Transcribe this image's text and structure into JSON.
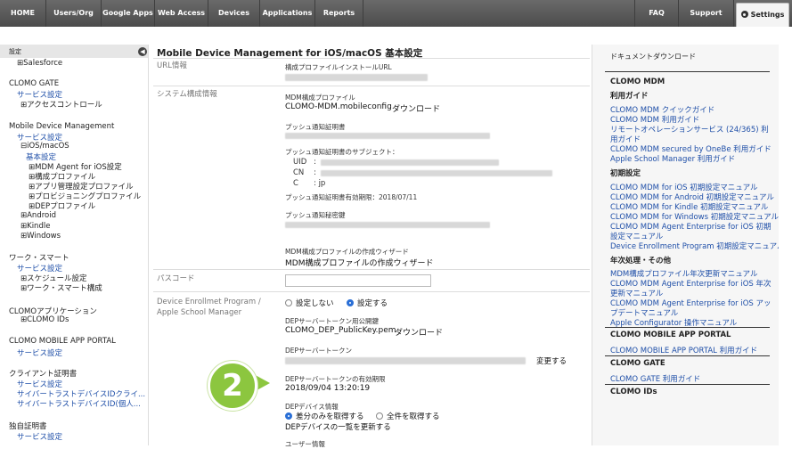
{
  "nav": {
    "items": [
      "HOME",
      "Users/Org",
      "Google Apps",
      "Web Access",
      "Devices",
      "Applications",
      "Reports"
    ],
    "faq": "FAQ",
    "support": "Support",
    "settings": "Settings"
  },
  "sidebar": {
    "header": "設定",
    "items": [
      {
        "text": "⊞Salesforce",
        "type": "tree"
      },
      {
        "text": "CLOMO GATE",
        "type": "sect"
      },
      {
        "text": "サービス設定",
        "type": "lnk"
      },
      {
        "text": "⊞アクセスコントロール",
        "type": "tree"
      },
      {
        "text": "Mobile Device Management",
        "type": "sect"
      },
      {
        "text": "サービス設定",
        "type": "lnk"
      },
      {
        "text": "⊟iOS/macOS",
        "type": "tree"
      },
      {
        "text": "基本設定",
        "type": "lnk"
      },
      {
        "text": "⊞MDM Agent for iOS設定",
        "type": "tree"
      },
      {
        "text": "⊞構成プロファイル",
        "type": "tree"
      },
      {
        "text": "⊞アプリ管理設定プロファイル",
        "type": "tree"
      },
      {
        "text": "⊞プロビジョニングプロファイル",
        "type": "tree"
      },
      {
        "text": "⊞DEPプロファイル",
        "type": "tree"
      },
      {
        "text": "⊞Android",
        "type": "tree"
      },
      {
        "text": "⊞Kindle",
        "type": "tree"
      },
      {
        "text": "⊞Windows",
        "type": "tree"
      },
      {
        "text": "ワーク・スマート",
        "type": "sect"
      },
      {
        "text": "サービス設定",
        "type": "lnk"
      },
      {
        "text": "⊞スケジュール設定",
        "type": "tree"
      },
      {
        "text": "⊞ワーク・スマート構成",
        "type": "tree"
      },
      {
        "text": "CLOMOアプリケーション",
        "type": "sect"
      },
      {
        "text": "⊞CLOMO IDs",
        "type": "tree"
      },
      {
        "text": "CLOMO MOBILE APP PORTAL",
        "type": "sect"
      },
      {
        "text": "サービス設定",
        "type": "lnk"
      },
      {
        "text": "クライアント証明書",
        "type": "sect"
      },
      {
        "text": "サービス設定",
        "type": "lnk"
      },
      {
        "text": "サイバートラストデバイスIDクライ...",
        "type": "lnk"
      },
      {
        "text": "サイバートラストデバイスID(個人...",
        "type": "lnk"
      },
      {
        "text": "独自証明書",
        "type": "sect"
      },
      {
        "text": "サービス設定",
        "type": "lnk"
      }
    ]
  },
  "main": {
    "title": "Mobile Device Management for iOS/macOS 基本設定",
    "url_label": "URL情報",
    "url_sub": "構成プロファイルインストールURL",
    "system_label": "システム構成情報",
    "mdm_profile_sub": "MDM構成プロファイル",
    "mdm_profile_file": "CLOMO-MDM.mobileconfig",
    "download": "ダウンロード",
    "push_cert_sub": "プッシュ通知証明書",
    "push_subject_sub": "プッシュ通知証明書のサブジェクト：",
    "uid": "UID",
    "cn": "CN",
    "c": "C",
    "c_value": ": jp",
    "push_expiry": "プッシュ通知証明書有効期限：2018/07/11",
    "push_key_sub": "プッシュ通知秘密鍵",
    "wizard_sub": "MDM構成プロファイルの作成ウィザード",
    "wizard_link": "MDM構成プロファイルの作成ウィザード",
    "passcode_label": "パスコード",
    "dep_label_1": "Device Enrollmet Program /",
    "dep_label_2": "Apple School Manager",
    "radio_off": "設定しない",
    "radio_on": "設定する",
    "dep_pubkey_sub": "DEPサーバートークン用公開鍵",
    "dep_pubkey_file": "CLOMO_DEP_PublicKey.pem",
    "dep_token_sub": "DEPサーバートークン",
    "change": "変更する",
    "dep_expiry_sub": "DEPサーバートークンの有効期限",
    "dep_expiry": "2018/09/04 13:20:19",
    "dep_device_sub": "DEPデバイス情報",
    "diff_only": "差分のみを取得する",
    "get_all": "全件を取得する",
    "update_link": "DEPデバイスの一覧を更新する",
    "user_info_sub": "ユーザー情報",
    "step_number": "2"
  },
  "right": {
    "title": "ドキュメントダウンロード",
    "sections": [
      {
        "text": "CLOMO MDM",
        "type": "head"
      },
      {
        "text": "利用ガイド",
        "type": "head"
      },
      {
        "text": "CLOMO MDM クイックガイド",
        "type": "lnk"
      },
      {
        "text": "CLOMO MDM 利用ガイド",
        "type": "lnk"
      },
      {
        "text": "リモートオペレーションサービス (24/365) 利",
        "type": "lnk"
      },
      {
        "text": "用ガイド",
        "type": "lnk"
      },
      {
        "text": "CLOMO MDM secured by OneBe 利用ガイド",
        "type": "lnk"
      },
      {
        "text": "Apple School Manager 利用ガイド",
        "type": "lnk"
      },
      {
        "text": "初期設定",
        "type": "head"
      },
      {
        "text": "CLOMO MDM for iOS 初期設定マニュアル",
        "type": "lnk"
      },
      {
        "text": "CLOMO MDM for Android 初期設定マニュアル",
        "type": "lnk"
      },
      {
        "text": "CLOMO MDM for Kindle 初期設定マニュアル",
        "type": "lnk"
      },
      {
        "text": "CLOMO MDM for Windows 初期設定マニュアル",
        "type": "lnk"
      },
      {
        "text": "CLOMO MDM Agent Enterprise for iOS 初期",
        "type": "lnk"
      },
      {
        "text": "設定マニュアル",
        "type": "lnk"
      },
      {
        "text": "Device Enrollment Program 初期設定マニュアル",
        "type": "lnk"
      },
      {
        "text": "年次処理・その他",
        "type": "head"
      },
      {
        "text": "MDM構成プロファイル年次更新マニュアル",
        "type": "lnk"
      },
      {
        "text": "CLOMO MDM Agent Enterprise for iOS 年次",
        "type": "lnk"
      },
      {
        "text": "更新マニュアル",
        "type": "lnk"
      },
      {
        "text": "CLOMO MDM Agent Enterprise for iOS アッ",
        "type": "lnk"
      },
      {
        "text": "プデートマニュアル",
        "type": "lnk"
      },
      {
        "text": "Apple Configurator 操作マニュアル",
        "type": "lnk"
      },
      {
        "text": "CLOMO MOBILE APP PORTAL",
        "type": "head"
      },
      {
        "text": "CLOMO MOBILE APP PORTAL 利用ガイド",
        "type": "lnk"
      },
      {
        "text": "CLOMO GATE",
        "type": "head"
      },
      {
        "text": "CLOMO GATE 利用ガイド",
        "type": "lnk"
      },
      {
        "text": "CLOMO IDs",
        "type": "head"
      }
    ]
  }
}
